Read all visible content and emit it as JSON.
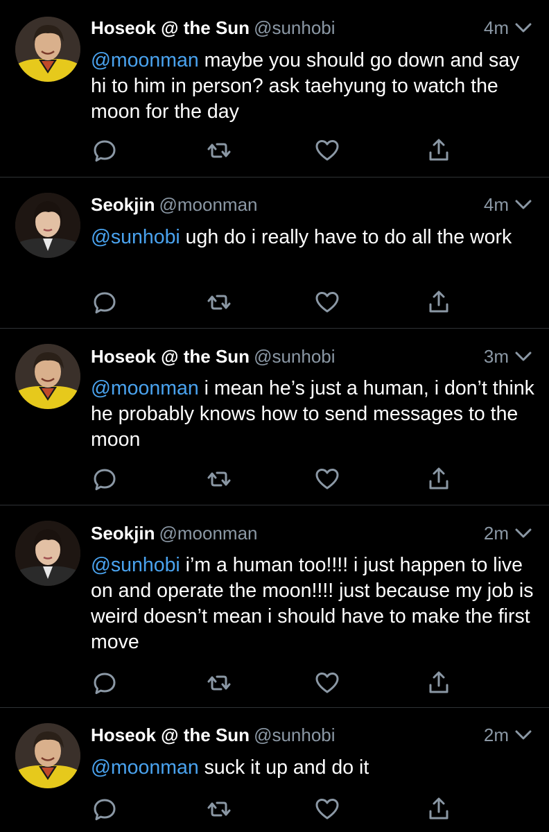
{
  "tweets": [
    {
      "display_name": "Hoseok @ the Sun",
      "handle": "@sunhobi",
      "time": "4m",
      "mention": "@moonman",
      "text": " maybe you should go down and say hi to him in person? ask taehyung to watch the moon for the day"
    },
    {
      "display_name": "Seokjin",
      "handle": "@moonman",
      "time": "4m",
      "mention": "@sunhobi",
      "text": " ugh do i really have to do all the work"
    },
    {
      "display_name": "Hoseok @ the Sun",
      "handle": "@sunhobi",
      "time": "3m",
      "mention": "@moonman",
      "text": " i mean he’s just a human, i don’t think he probably knows how to send messages to the moon"
    },
    {
      "display_name": "Seokjin",
      "handle": "@moonman",
      "time": "2m",
      "mention": "@sunhobi",
      "text": " i’m a human too!!!! i just happen to live on and operate the moon!!!! just because my job is weird doesn’t mean i should have to make the first move"
    },
    {
      "display_name": "Hoseok @ the Sun",
      "handle": "@sunhobi",
      "time": "2m",
      "mention": "@moonman",
      "text": " suck it up and do it"
    }
  ],
  "icons": {
    "reply": "reply-icon",
    "retweet": "retweet-icon",
    "like": "like-icon",
    "share": "share-icon",
    "caret": "chevron-down-icon"
  },
  "colors": {
    "background": "#000000",
    "text": "#ffffff",
    "secondary": "#8b98a5",
    "mention": "#4aa3ef",
    "divider": "#2f3336"
  }
}
